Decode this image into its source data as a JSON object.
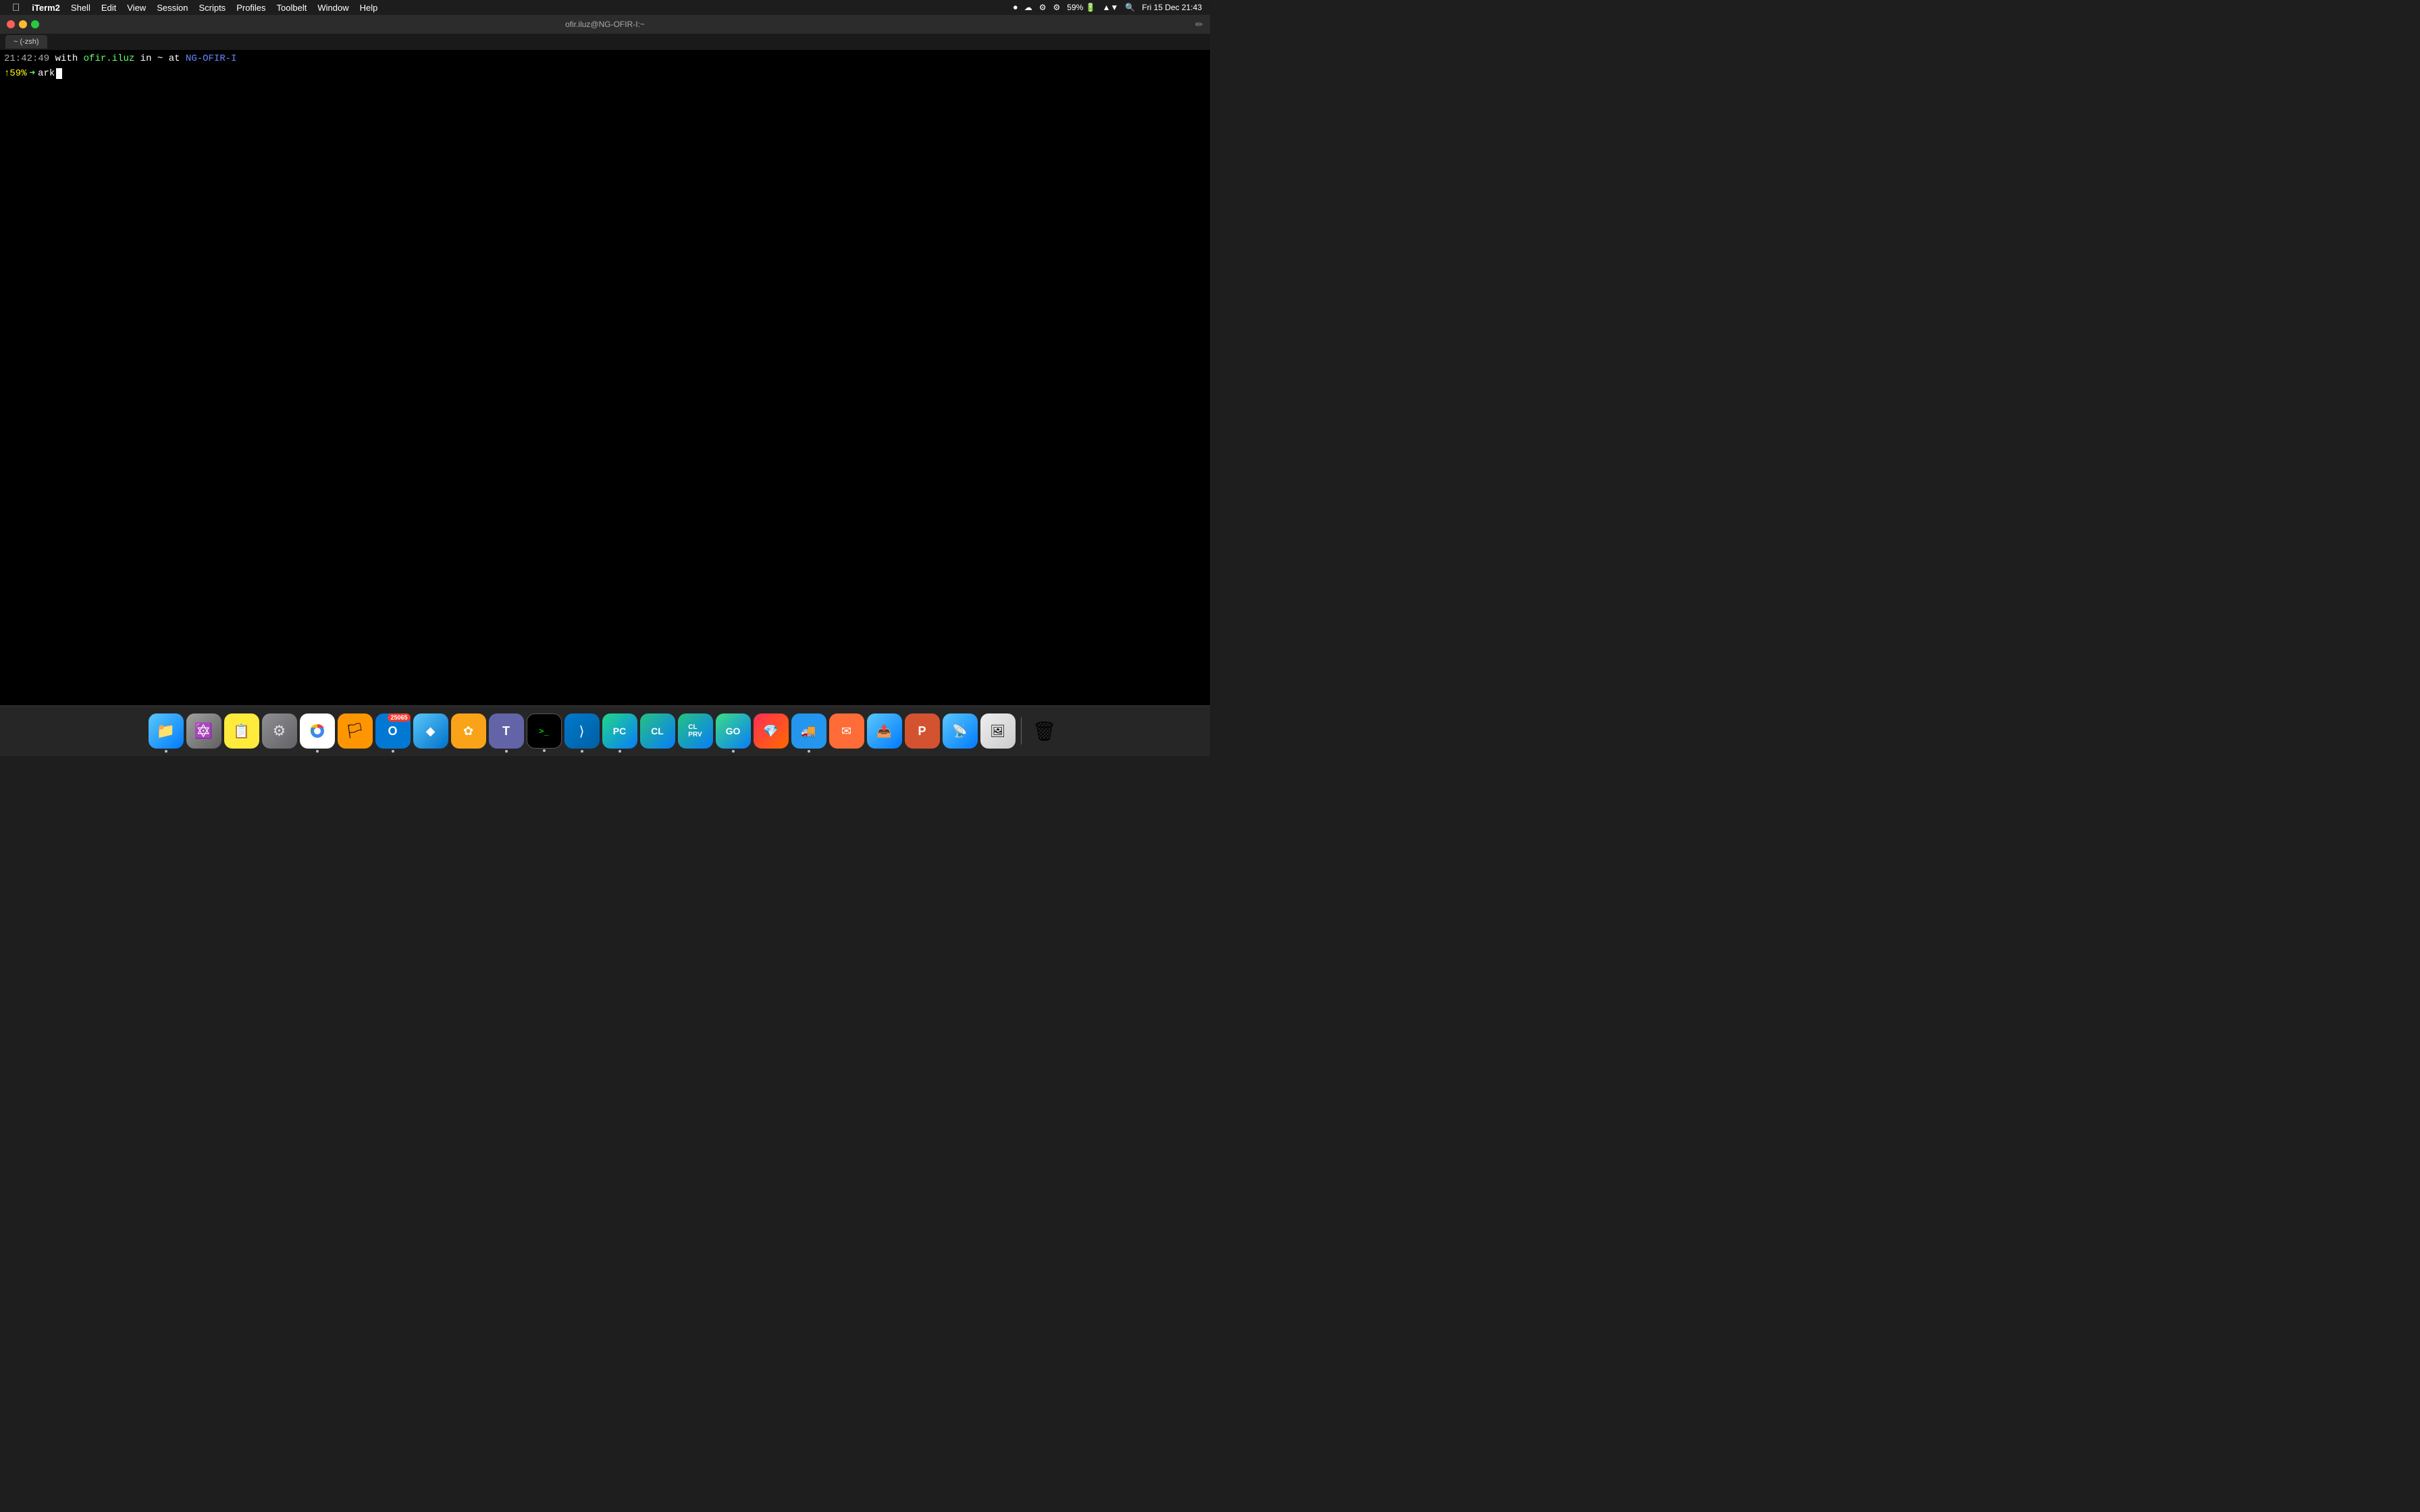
{
  "menubar": {
    "apple_logo": "",
    "app_name": "iTerm2",
    "items": [
      "Shell",
      "Edit",
      "View",
      "Session",
      "Scripts",
      "Profiles",
      "Toolbelt",
      "Window",
      "Help"
    ],
    "status_items": [
      "⏺",
      "☁",
      "⚙",
      "⚙",
      "🔋",
      "📶",
      "🔍",
      "⌨",
      "Fri 15 Dec",
      "21:43"
    ]
  },
  "title_bar": {
    "window_title": "ofir.iluz@NG-OFIR-I:~"
  },
  "tab": {
    "label": "~ (-zsh)"
  },
  "terminal": {
    "line1_time": "21:42:49",
    "line1_with": "with",
    "line1_user": "ofir.iluz",
    "line1_in": "in",
    "line1_dir": "~",
    "line1_at": "at",
    "line1_host": "NG-OFIR-I",
    "line2_exitcode": "↑59%",
    "line2_arrow": "➜",
    "line2_command": "ark"
  },
  "dock": {
    "items": [
      {
        "name": "finder",
        "label": "Finder",
        "has_dot": true
      },
      {
        "name": "launchpad",
        "label": "Launchpad",
        "has_dot": false
      },
      {
        "name": "stickies",
        "label": "Stickies",
        "has_dot": false
      },
      {
        "name": "system-preferences",
        "label": "System Preferences",
        "has_dot": false
      },
      {
        "name": "chrome",
        "label": "Google Chrome",
        "has_dot": true
      },
      {
        "name": "firefox",
        "label": "Firefox",
        "has_dot": false
      },
      {
        "name": "outlook",
        "label": "Outlook",
        "badge": "25065",
        "has_dot": true
      },
      {
        "name": "blue-app1",
        "label": "App",
        "has_dot": false
      },
      {
        "name": "sketch",
        "label": "Sketch",
        "has_dot": false
      },
      {
        "name": "teams",
        "label": "Teams",
        "has_dot": true
      },
      {
        "name": "terminal",
        "label": "Terminal",
        "has_dot": true
      },
      {
        "name": "vscode",
        "label": "VS Code",
        "has_dot": true
      },
      {
        "name": "pycharm",
        "label": "PyCharm",
        "has_dot": true
      },
      {
        "name": "clion",
        "label": "CLion",
        "has_dot": false
      },
      {
        "name": "clion-preview",
        "label": "CLion Preview",
        "has_dot": false
      },
      {
        "name": "goland",
        "label": "GoLand",
        "has_dot": true
      },
      {
        "name": "rubymine",
        "label": "RubyMine",
        "has_dot": false
      },
      {
        "name": "docker",
        "label": "Docker",
        "has_dot": true
      },
      {
        "name": "postman",
        "label": "Postman",
        "has_dot": false
      },
      {
        "name": "transporter",
        "label": "Transporter",
        "has_dot": false
      },
      {
        "name": "ppt",
        "label": "PowerPoint",
        "has_dot": false
      },
      {
        "name": "radar",
        "label": "Radar",
        "has_dot": false
      },
      {
        "name": "preview",
        "label": "Preview",
        "has_dot": false
      },
      {
        "name": "trash",
        "label": "Trash",
        "has_dot": false
      }
    ]
  }
}
